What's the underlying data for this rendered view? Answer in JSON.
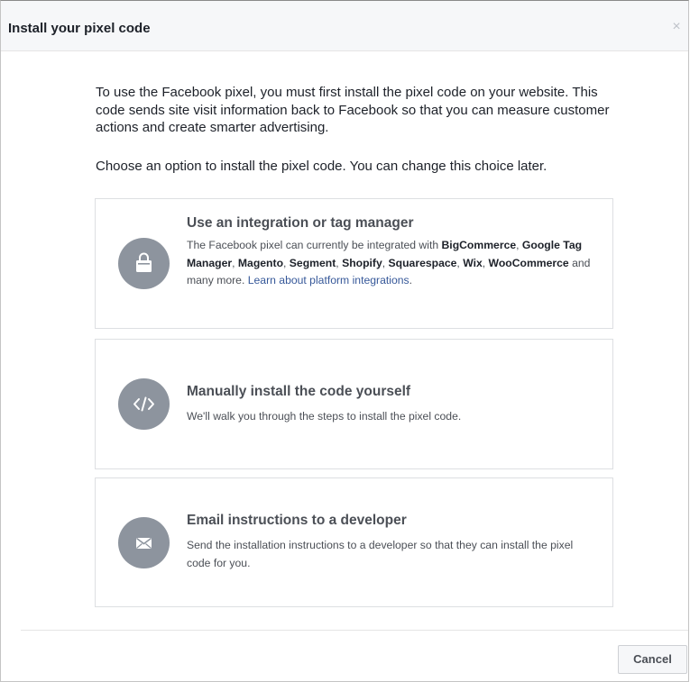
{
  "dialog": {
    "title": "Install your pixel code",
    "close_label": "×"
  },
  "intro": {
    "text": "To use the Facebook pixel, you must first install the pixel code on your website. This code sends site visit information back to Facebook so that you can measure customer actions and create smarter advertising.",
    "choose_text": "Choose an option to install the pixel code. You can change this choice later."
  },
  "options": [
    {
      "icon": "shopping-bag-icon",
      "title": "Use an integration or tag manager",
      "desc_prefix": "The Facebook pixel can currently be integrated with ",
      "platforms": [
        "BigCommerce",
        "Google Tag Manager",
        "Magento",
        "Segment",
        "Shopify",
        "Squarespace",
        "Wix",
        "WooCommerce"
      ],
      "sep": ", ",
      "desc_suffix": " and many more. ",
      "link": "Learn about platform integrations",
      "desc_end": "."
    },
    {
      "icon": "code-icon",
      "title": "Manually install the code yourself",
      "desc": "We'll walk you through the steps to install the pixel code."
    },
    {
      "icon": "envelope-icon",
      "title": "Email instructions to a developer",
      "desc": "Send the installation instructions to a developer so that they can install the pixel code for you."
    }
  ],
  "footer": {
    "cancel_label": "Cancel"
  },
  "colors": {
    "icon_bg": "#8d949e",
    "link": "#365899"
  }
}
